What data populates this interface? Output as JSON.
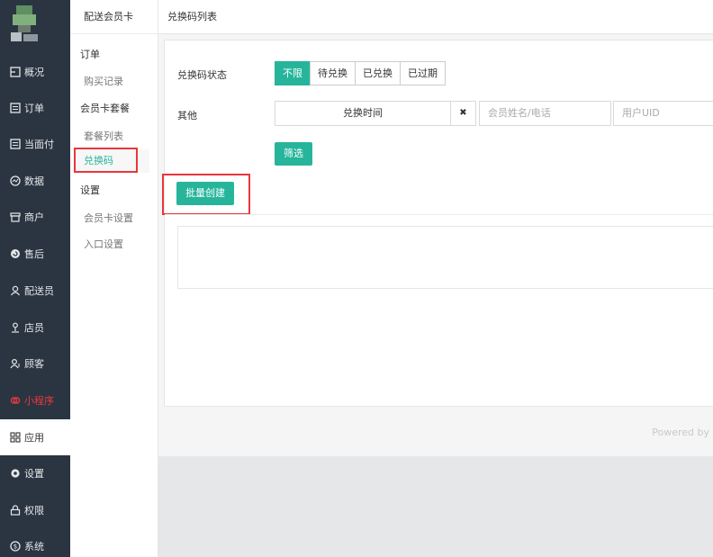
{
  "nav": {
    "items": [
      {
        "key": "overview",
        "label": "概况",
        "icon": "dashboard-icon"
      },
      {
        "key": "orders",
        "label": "订单",
        "icon": "list-icon"
      },
      {
        "key": "counter",
        "label": "当面付",
        "icon": "list-icon"
      },
      {
        "key": "data",
        "label": "数据",
        "icon": "chart-icon"
      },
      {
        "key": "merchant",
        "label": "商户",
        "icon": "store-icon"
      },
      {
        "key": "aftersale",
        "label": "售后",
        "icon": "aftersale-icon"
      },
      {
        "key": "courier",
        "label": "配送员",
        "icon": "user-icon"
      },
      {
        "key": "staff",
        "label": "店员",
        "icon": "staff-icon"
      },
      {
        "key": "customer",
        "label": "顾客",
        "icon": "users-icon"
      },
      {
        "key": "miniprogram",
        "label": "小程序",
        "icon": "miniprogram-icon"
      },
      {
        "key": "apps",
        "label": "应用",
        "icon": "grid-icon"
      },
      {
        "key": "settings",
        "label": "设置",
        "icon": "gear-icon"
      },
      {
        "key": "permission",
        "label": "权限",
        "icon": "lock-icon"
      },
      {
        "key": "system",
        "label": "系统",
        "icon": "system-icon"
      }
    ],
    "active": "apps"
  },
  "subnav": {
    "title": "配送会员卡",
    "group_orders": "订单",
    "link_purchase": "购买记录",
    "group_packages": "会员卡套餐",
    "link_package_list": "套餐列表",
    "link_redeem_code": "兑换码",
    "group_settings": "设置",
    "link_card_settings": "会员卡设置",
    "link_entry_settings": "入口设置"
  },
  "topbar": {
    "title": "兑换码列表"
  },
  "filters": {
    "status_label": "兑换码状态",
    "status_options": [
      "不限",
      "待兑换",
      "已兑换",
      "已过期"
    ],
    "status_selected": "不限",
    "other_label": "其他",
    "time_field": "兑换时间",
    "clear_symbol": "✖",
    "member_placeholder": "会员姓名/电话",
    "uid_placeholder": "用户UID",
    "filter_button": "筛选"
  },
  "actions": {
    "batch_create": "批量创建"
  },
  "footer": {
    "powered": "Powered by"
  },
  "colors": {
    "accent": "#26b59a",
    "nav_bg": "#2b3541",
    "highlight": "#e8373c"
  }
}
